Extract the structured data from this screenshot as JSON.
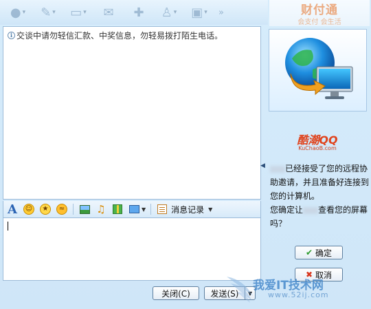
{
  "window": {
    "brand_name": "财付通",
    "brand_slogan": "会支付 会生活"
  },
  "toolbar": {
    "items": [
      {
        "icon": "video-call-icon",
        "glyph": "●",
        "has_menu": true
      },
      {
        "icon": "voice-call-icon",
        "glyph": "✎",
        "has_menu": true
      },
      {
        "icon": "folder-icon",
        "glyph": "▭",
        "has_menu": true
      },
      {
        "icon": "send-mail-icon",
        "glyph": "✉",
        "has_menu": false
      },
      {
        "icon": "add-app-icon",
        "glyph": "✚",
        "has_menu": false
      },
      {
        "icon": "person-info-icon",
        "glyph": "♙",
        "has_menu": true
      },
      {
        "icon": "remote-assist-icon",
        "glyph": "▣",
        "has_menu": true
      }
    ],
    "more_glyph": "»"
  },
  "chat": {
    "notice": "交谈中请勿轻信汇款、中奖信息，勿轻易拨打陌生电话。"
  },
  "format_bar": {
    "history_label": "消息记录"
  },
  "buttons": {
    "close": "关闭(C)",
    "send": "发送(S)",
    "send_drop": "▼",
    "accept": "确定",
    "cancel": "取消"
  },
  "right_panel": {
    "kuchao_title": "酷潮QQ",
    "kuchao_site": "KuChaoB.com",
    "msg_line1": "已经接受了您的远程协助邀请，并且准备好连接到您的计算机。",
    "msg_line2_pre": "您确定让",
    "msg_line2_post": "查看您的屏幕吗？",
    "arrow": "◀"
  },
  "watermark": {
    "line1": "我爱IT技术网",
    "line2": "www.52ij.com"
  },
  "colors": {
    "accent": "#2b64b4",
    "panel_bg": "#d6ecfb",
    "border": "#9bbbd9"
  }
}
